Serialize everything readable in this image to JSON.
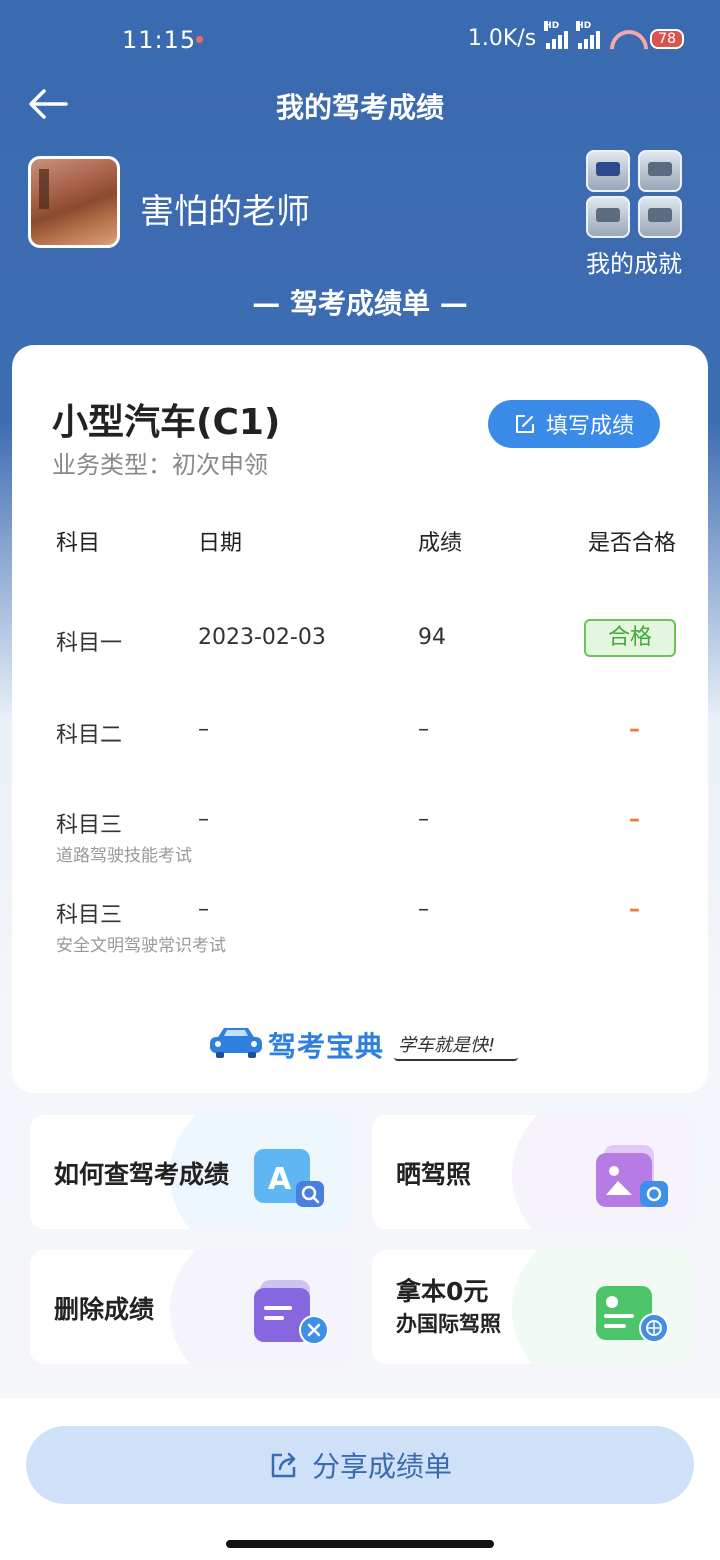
{
  "status_bar": {
    "time": "11:15",
    "net_speed": "1.0K/s",
    "hd1": "HD",
    "hd2": "HD",
    "battery": "78"
  },
  "header": {
    "title": "我的驾考成绩"
  },
  "profile": {
    "username": "害怕的老师",
    "achievements_label": "我的成就"
  },
  "report_title": "— 驾考成绩单 —",
  "card": {
    "car_type": "小型汽车(C1)",
    "business_type": "业务类型：初次申领",
    "fill_button_label": "填写成绩",
    "columns": [
      "科目",
      "日期",
      "成绩",
      "是否合格"
    ],
    "rows": [
      {
        "subject": "科目一",
        "sub": "",
        "date": "2023-02-03",
        "score": "94",
        "passed": "合格"
      },
      {
        "subject": "科目二",
        "sub": "",
        "date": "–",
        "score": "–",
        "passed": "–"
      },
      {
        "subject": "科目三",
        "sub": "道路驾驶技能考试",
        "date": "–",
        "score": "–",
        "passed": "–"
      },
      {
        "subject": "科目三",
        "sub": "安全文明驾驶常识考试",
        "date": "–",
        "score": "–",
        "passed": "–"
      }
    ],
    "brand_name": "驾考宝典",
    "brand_slogan": "学车就是快!"
  },
  "tiles": {
    "check_score": "如何查驾考成绩",
    "show_license": "晒驾照",
    "delete_score": "删除成绩",
    "intl_license_line1": "拿本0元",
    "intl_license_line2": "办国际驾照"
  },
  "share_button": "分享成绩单",
  "colors": {
    "header_blue": "#3a6ab0",
    "accent_blue": "#3a8be8",
    "pass_green": "#45a93a",
    "dash_orange": "#f07a3a"
  }
}
